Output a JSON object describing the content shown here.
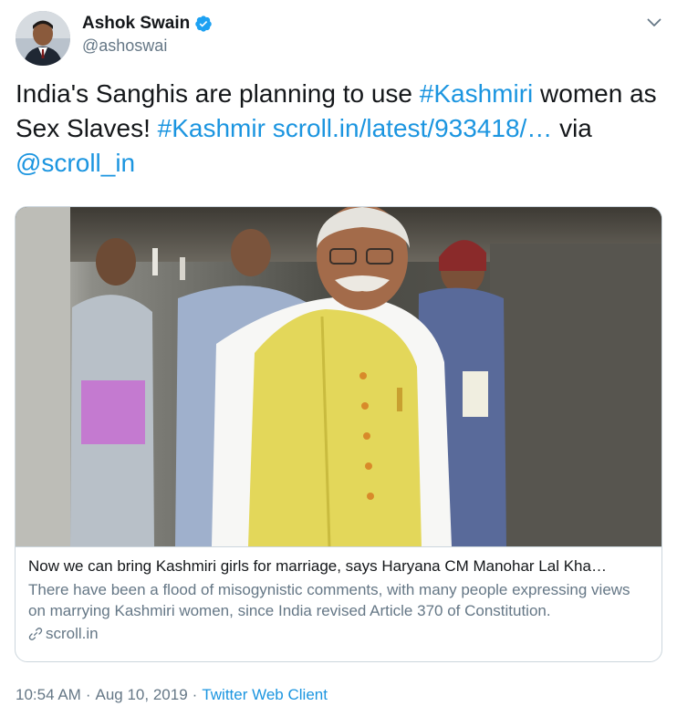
{
  "author": {
    "name": "Ashok Swain",
    "handle": "@ashoswai",
    "verified": true
  },
  "tweet": {
    "parts": [
      {
        "text": "India's Sanghis are planning to use ",
        "type": "text"
      },
      {
        "text": "#Kashmiri",
        "type": "link"
      },
      {
        "text": " women as Sex Slaves! ",
        "type": "text"
      },
      {
        "text": "#Kashmir",
        "type": "link"
      },
      {
        "text": " ",
        "type": "text"
      },
      {
        "text": "scroll.in/latest/933418/…",
        "type": "link"
      },
      {
        "text": " via ",
        "type": "text"
      },
      {
        "text": "@scroll_in",
        "type": "link"
      }
    ]
  },
  "card": {
    "title": "Now we can bring Kashmiri girls for marriage, says Haryana CM Manohar Lal Kha…",
    "description": "There have been a flood of misogynistic comments, with many people expressing views on marrying Kashmiri women, since India revised Article 370 of Constitution.",
    "domain": "scroll.in"
  },
  "meta": {
    "time": "10:54 AM",
    "separator": "·",
    "date": "Aug 10, 2019",
    "client": "Twitter Web Client"
  },
  "colors": {
    "link": "#1b95e0",
    "secondary": "#657786",
    "primary": "#14171a",
    "border": "#ccd6dd"
  },
  "icons": {
    "verified": "verified-badge-icon",
    "caret": "chevron-down-icon",
    "link": "link-icon"
  }
}
